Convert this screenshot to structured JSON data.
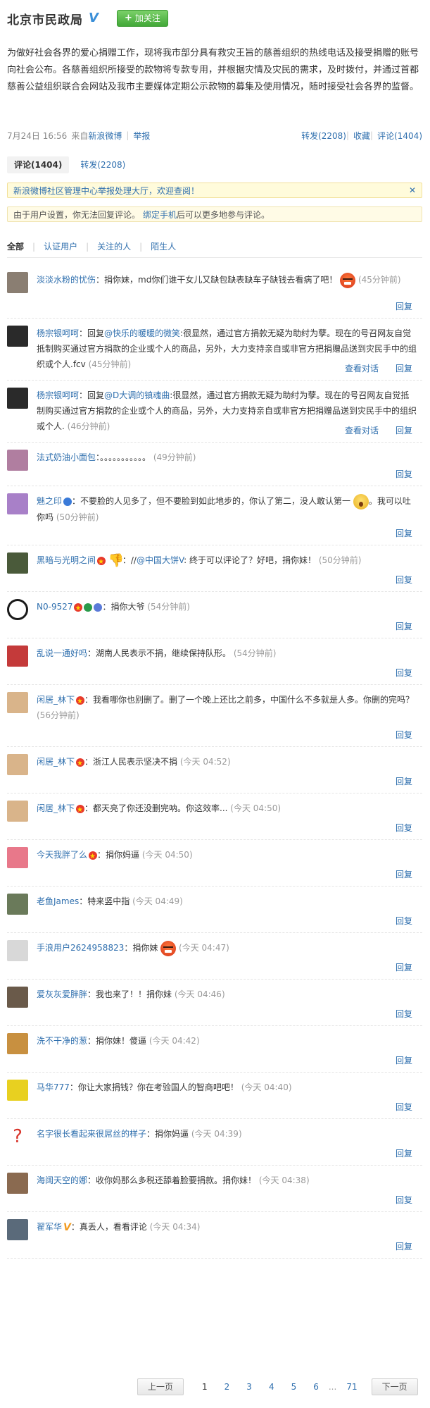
{
  "header": {
    "account_name": "北京市民政局",
    "follow_label": "加关注"
  },
  "post": {
    "text": "为做好社会各界的爱心捐赠工作，现将我市部分具有救灾王旨的慈善组织的热线电话及接受捐赠的账号向社会公布。各慈善组织所接受的款物将专款专用，并根据灾情及灾民的需求，及时拨付，并通过首都慈善公益组织联合会网站及我市主要媒体定期公示款物的募集及使用情况，随时接受社会各界的监督。",
    "date": "7月24日 16:56",
    "source_prefix": "来自",
    "source": "新浪微博",
    "report": "举报",
    "repost": "转发(2208)",
    "favorite": "收藏",
    "comment": "评论(1404)"
  },
  "tabs": {
    "comments": "评论(1404)",
    "reposts": "转发(2208)"
  },
  "notices": {
    "community": "新浪微博社区管理中心举报处理大厅，欢迎查阅！",
    "community_close": "✕",
    "restriction_prefix": "由于用户设置，你无法回复评论。",
    "restriction_link": "绑定手机",
    "restriction_suffix": "后可以更多地参与评论。"
  },
  "filters": [
    "全部",
    "认证用户",
    "关注的人",
    "陌生人"
  ],
  "reply_label": "回复",
  "view_dialog_label": "查看对话",
  "comments": [
    {
      "user": "淡淡水粉的忧伤",
      "text": "：捐你妹，md你们谁干女儿又缺包缺表缺车子缺钱去看病了吧！",
      "time": "(45分钟前)",
      "avatar_color": "#8a7e72"
    },
    {
      "user": "杨宗银呵呵",
      "reply_prefix": "：回复",
      "mention": "@快乐的暖暖的微笑",
      "text": ":很显然，通过官方捐款无疑为助纣为孽。现在的号召网友自觉抵制购买通过官方捐款的企业或个人的商品，另外，大力支持亲自或非官方把捐赠品送到灾民手中的组织或个人.fcv",
      "time": "(45分钟前)",
      "avatar_color": "#2a2a2a"
    },
    {
      "user": "杨宗银呵呵",
      "reply_prefix": "：回复",
      "mention": "@D大调的镇魂曲",
      "text": ":很显然，通过官方捐款无疑为助纣为孽。现在的号召网友自觉抵制购买通过官方捐款的企业或个人的商品，另外，大力支持亲自或非官方把捐赠品送到灾民手中的组织或个人.",
      "time": "(46分钟前)",
      "avatar_color": "#2a2a2a"
    },
    {
      "user": "法式奶油小面包",
      "text": "：。。。。。。。。。。。",
      "time": "(49分钟前)",
      "avatar_color": "#b07ea0"
    },
    {
      "user": "魅之印",
      "text": "：不要脸的人见多了，但不要脸到如此地步的，你认了第二，没人敢认第一",
      "text2": "。我可以吐你吗",
      "time": "(50分钟前)",
      "avatar_color": "#a880c8"
    },
    {
      "user": "黑暗与光明之间",
      "mention": "@中国大饼V",
      "text": ": 终于可以评论了？好吧，捐你妹！",
      "time": "(50分钟前)",
      "avatar_color": "#4a5a3a"
    },
    {
      "user": "N0-9527",
      "text": "：捐你大爷",
      "time": "(54分钟前)",
      "avatar_color": "#1a1a1a"
    },
    {
      "user": "乱说一通好吗",
      "text": "：湖南人民表示不捐，继续保持队形。",
      "time": "(54分钟前)",
      "avatar_color": "#c43a3a"
    },
    {
      "user": "闲居_林下",
      "text": "：我看哪你也别删了。删了一个晚上还比之前多，中国什么不多就是人多。你删的完吗？",
      "time": "(56分钟前)",
      "avatar_color": "#d9b48a"
    },
    {
      "user": "闲居_林下",
      "text": "：浙江人民表示坚决不捐",
      "time": "(今天 04:52)",
      "avatar_color": "#d9b48a"
    },
    {
      "user": "闲居_林下",
      "text": "：都天亮了你还没删完呐。你这效率...",
      "time": "(今天 04:50)",
      "avatar_color": "#d9b48a"
    },
    {
      "user": "今天我胖了么",
      "text": "：捐你妈逼",
      "time": "(今天 04:50)",
      "avatar_color": "#e8788a"
    },
    {
      "user": "老鱼James",
      "text": "：特来竖中指",
      "time": "(今天 04:49)",
      "avatar_color": "#6a7a5a"
    },
    {
      "user": "手浪用户2624958823",
      "text": "：捐你妹",
      "time": "(今天 04:47)",
      "avatar_color": "#d8d8d8"
    },
    {
      "user": "爱灰灰爱胖胖",
      "text": "：我也来了！！捐你妹",
      "time": "(今天 04:46)",
      "avatar_color": "#6a5a4a"
    },
    {
      "user": "洗不干净的葱",
      "text": "：捐你妹！傻逼",
      "time": "(今天 04:42)",
      "avatar_color": "#c89040"
    },
    {
      "user": "马华777",
      "text": "：你让大家捐钱？你在考验国人的智商吧吧！",
      "time": "(今天 04:40)",
      "avatar_color": "#e8d020"
    },
    {
      "user": "名字很长看起来很屌丝的样子",
      "text": "：捐你妈逼",
      "time": "(今天 04:39)",
      "avatar_color": "#ffffff"
    },
    {
      "user": "海阔天空的娜",
      "text": "：收你妈那么多税还舔着脸要捐款。捐你妹！",
      "time": "(今天 04:38)",
      "avatar_color": "#8a6a50"
    },
    {
      "user": "翟军华",
      "text": "：真丢人，看看评论",
      "time": "(今天 04:34)",
      "avatar_color": "#5a6a7a"
    }
  ],
  "pager": {
    "prev": "上一页",
    "pages": [
      "1",
      "2",
      "3",
      "4",
      "5",
      "6"
    ],
    "ellipsis": "...",
    "last": "71",
    "next": "下一页"
  }
}
